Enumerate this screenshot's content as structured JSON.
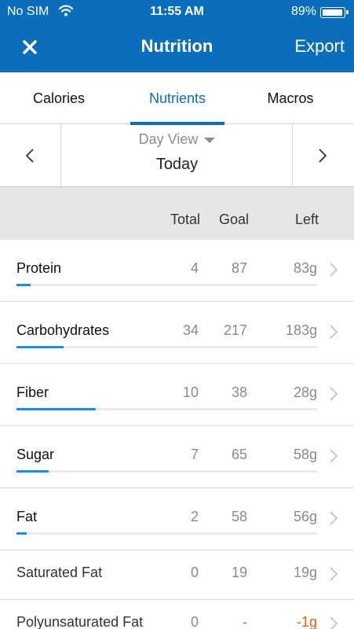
{
  "status_bar": {
    "carrier": "No SIM",
    "time": "11:55 AM",
    "battery": "89%",
    "wifi_icon": "wifi-icon"
  },
  "nav": {
    "close_icon": "close-icon",
    "title": "Nutrition",
    "export_label": "Export"
  },
  "tabs": [
    {
      "label": "Calories",
      "active": false
    },
    {
      "label": "Nutrients",
      "active": true
    },
    {
      "label": "Macros",
      "active": false
    }
  ],
  "day_selector": {
    "mode": "Day View",
    "date": "Today"
  },
  "columns": {
    "total": "Total",
    "goal": "Goal",
    "left": "Left"
  },
  "nutrients": [
    {
      "name": "Protein",
      "total": "4",
      "goal": "87",
      "left": "83g",
      "progress": 0.046,
      "negative": false
    },
    {
      "name": "Carbohydrates",
      "total": "34",
      "goal": "217",
      "left": "183g",
      "progress": 0.157,
      "negative": false
    },
    {
      "name": "Fiber",
      "total": "10",
      "goal": "38",
      "left": "28g",
      "progress": 0.263,
      "negative": false
    },
    {
      "name": "Sugar",
      "total": "7",
      "goal": "65",
      "left": "58g",
      "progress": 0.108,
      "negative": false
    },
    {
      "name": "Fat",
      "total": "2",
      "goal": "58",
      "left": "56g",
      "progress": 0.034,
      "negative": false
    },
    {
      "name": "Saturated Fat",
      "total": "0",
      "goal": "19",
      "left": "19g",
      "negative": false
    },
    {
      "name": "Polyunsaturated Fat",
      "total": "0",
      "goal": "-",
      "left": "-1g",
      "negative": true
    }
  ],
  "colors": {
    "brand": "#0a6ebd",
    "progress": "#1a8ee6",
    "over": "#e0620d"
  }
}
